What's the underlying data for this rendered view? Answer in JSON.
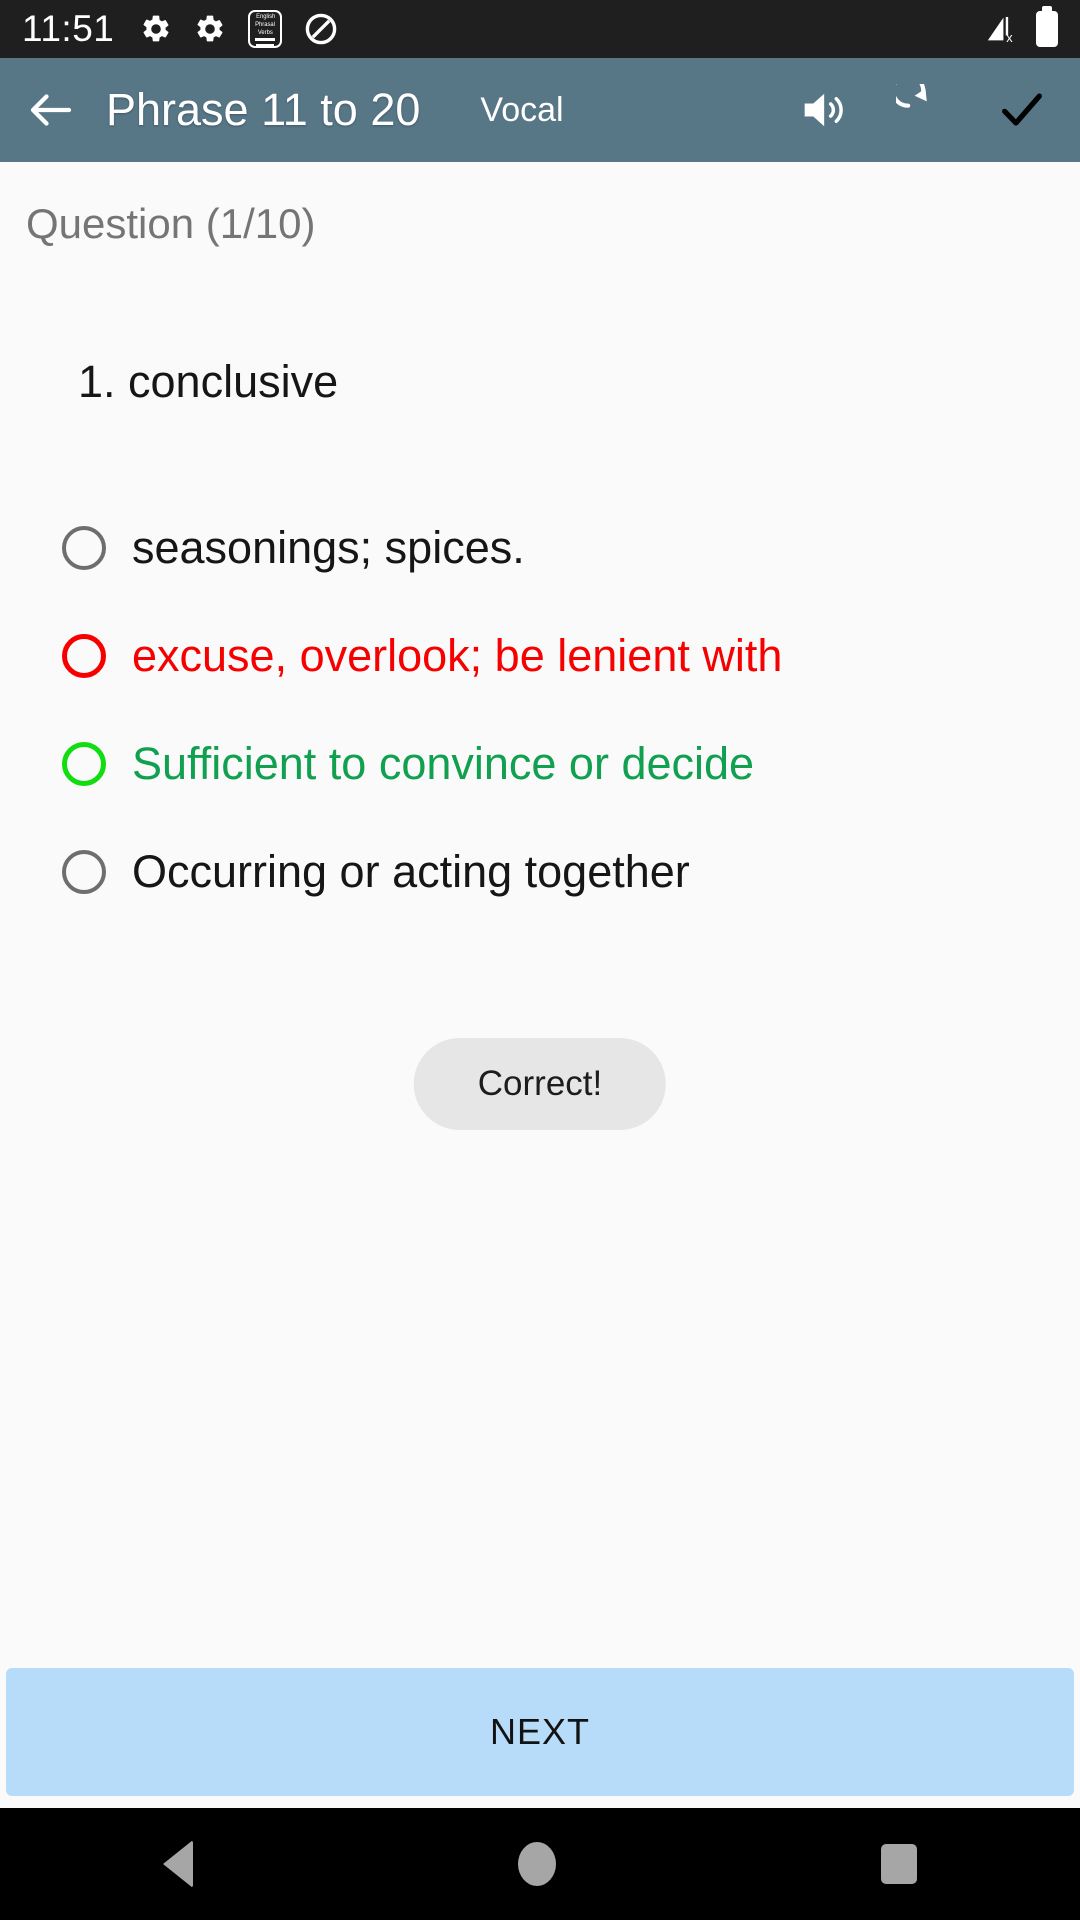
{
  "status_bar": {
    "time": "11:51",
    "left_icons": [
      {
        "name": "settings-gear-icon-1",
        "glyph": "gear"
      },
      {
        "name": "settings-gear-icon-2",
        "glyph": "gear"
      },
      {
        "name": "app-notification-icon",
        "glyph": "app-badge"
      },
      {
        "name": "do-not-disturb-icon",
        "glyph": "dnd"
      }
    ],
    "app_badge_lines": [
      "English",
      "Phrasal",
      "Verbs"
    ],
    "right_icons": [
      {
        "name": "cellular-signal-off-icon",
        "glyph": "signal-x"
      },
      {
        "name": "battery-full-icon",
        "glyph": "battery"
      }
    ]
  },
  "app_bar": {
    "back_label": "back",
    "title": "Phrase 11 to 20",
    "mode_label": "Vocal",
    "actions": [
      {
        "name": "speaker-icon",
        "label": "sound"
      },
      {
        "name": "restart-icon",
        "label": "restart"
      },
      {
        "name": "check-icon",
        "label": "confirm"
      }
    ]
  },
  "quiz": {
    "counter": "Question (1/10)",
    "question": "1. conclusive",
    "options": [
      {
        "label": "seasonings; spices.",
        "state": "neutral"
      },
      {
        "label": "excuse, overlook; be lenient with",
        "state": "wrong"
      },
      {
        "label": "Sufficient to convince or decide",
        "state": "correct"
      },
      {
        "label": "Occurring or acting together",
        "state": "neutral"
      }
    ],
    "toast": "Correct!"
  },
  "footer": {
    "next_label": "NEXT"
  },
  "nav_bar": {
    "buttons": [
      {
        "name": "nav-back-button",
        "label": "Back"
      },
      {
        "name": "nav-home-button",
        "label": "Home"
      },
      {
        "name": "nav-recents-button",
        "label": "Recents"
      }
    ]
  },
  "colors": {
    "app_bar": "#577686",
    "correct_ring": "#11dd11",
    "correct_text": "#10a050",
    "wrong": "#f60000",
    "next_button": "#b6dcfa",
    "background": "#fafafa"
  }
}
